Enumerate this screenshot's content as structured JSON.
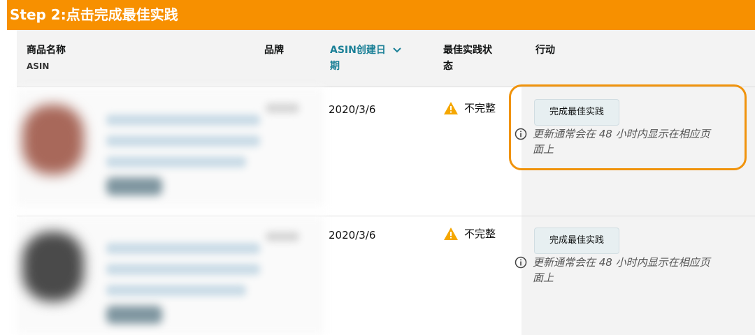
{
  "banner": {
    "title": "Step 2:点击完成最佳实践"
  },
  "colors": {
    "banner": "#f79000",
    "highlight": "#f0930c",
    "link": "#1b8097",
    "warning": "#f5a700"
  },
  "table": {
    "headers": {
      "product_name": "商品名称",
      "product_name_sub": "ASIN",
      "brand": "品牌",
      "asin_date_line1": "ASIN创建日",
      "asin_date_line2": "期",
      "asin_date_icon": "chevron-down-icon",
      "status_line1": "最佳实践状",
      "status_line2": "态",
      "action": "行动"
    },
    "rows": [
      {
        "date": "2020/3/6",
        "status_icon": "warning-icon",
        "status": "不完整",
        "action_button": "完成最佳实践",
        "note_icon": "info-icon",
        "note_line1": "更新通常会在 48 小时内显示在相应页",
        "note_line2": "面上"
      },
      {
        "date": "2020/3/6",
        "status_icon": "warning-icon",
        "status": "不完整",
        "action_button": "完成最佳实践",
        "note_icon": "info-icon",
        "note_line1": "更新通常会在 48 小时内显示在相应页",
        "note_line2": "面上"
      }
    ]
  }
}
